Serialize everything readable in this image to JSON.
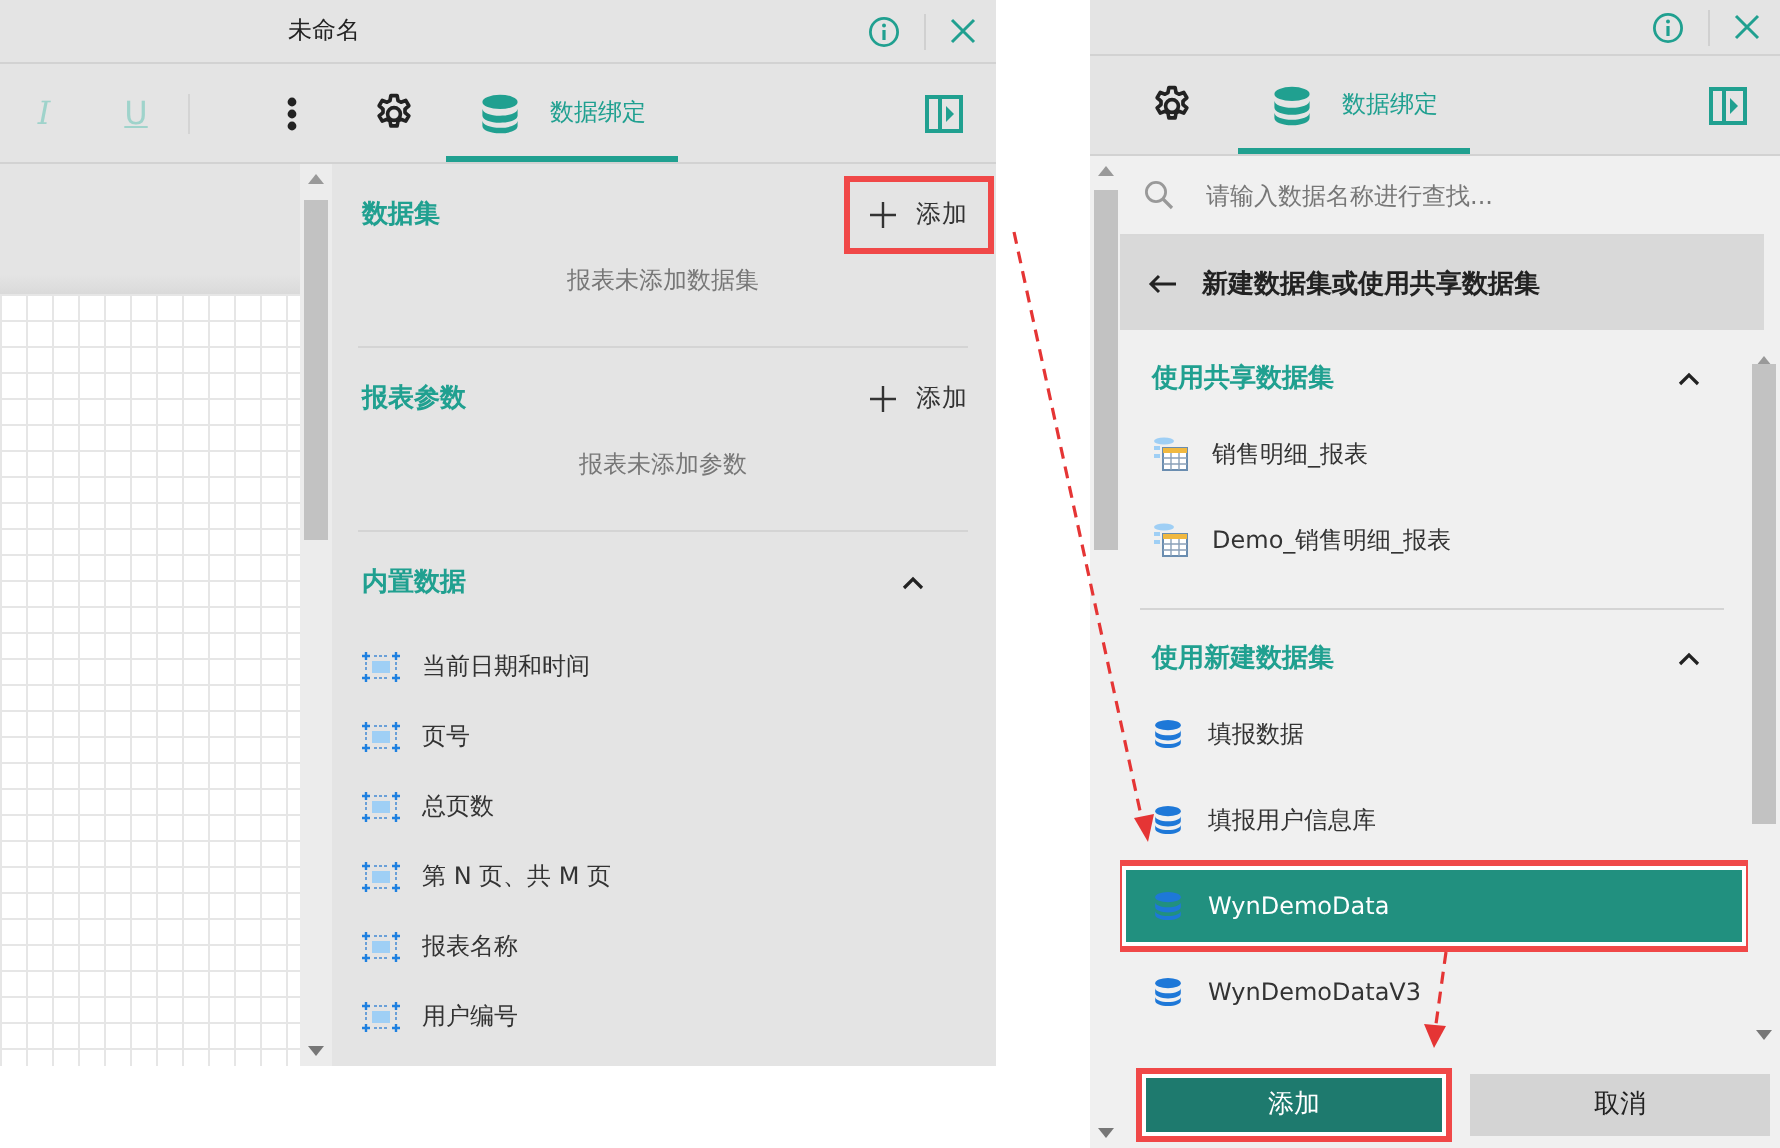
{
  "left_panel": {
    "window": {
      "title": "未命名"
    },
    "format_buttons": [
      {
        "label": "I",
        "disabled": true
      },
      {
        "label": "U",
        "disabled": true
      }
    ],
    "tabs": [
      {
        "kind": "settings",
        "selected": false
      },
      {
        "kind": "data",
        "label": "数据绑定",
        "selected": true
      }
    ],
    "sections": [
      {
        "title": "数据集",
        "action": {
          "label": "添加",
          "highlighted": true
        },
        "empty_text": "报表未添加数据集"
      },
      {
        "title": "报表参数",
        "action": {
          "label": "添加",
          "highlighted": false
        },
        "empty_text": "报表未添加参数"
      }
    ],
    "builtin": {
      "title": "内置数据",
      "expanded": true,
      "items": [
        "当前日期和时间",
        "页号",
        "总页数",
        "第 N 页、共 M 页",
        "报表名称",
        "用户编号"
      ]
    }
  },
  "right_panel": {
    "tabs": [
      {
        "kind": "settings",
        "selected": false
      },
      {
        "kind": "data",
        "label": "数据绑定",
        "selected": true
      }
    ],
    "search": {
      "placeholder": "请输入数据名称进行查找..."
    },
    "back_header": "新建数据集或使用共享数据集",
    "groups": [
      {
        "title": "使用共享数据集",
        "expanded": true,
        "items": [
          {
            "label": "销售明细_报表",
            "kind": "shared",
            "selected": false,
            "highlighted": false
          },
          {
            "label": "Demo_销售明细_报表",
            "kind": "shared",
            "selected": false,
            "highlighted": false
          }
        ]
      },
      {
        "title": "使用新建数据集",
        "expanded": true,
        "items": [
          {
            "label": "填报数据",
            "kind": "database",
            "selected": false,
            "highlighted": false
          },
          {
            "label": "填报用户信息库",
            "kind": "database",
            "selected": false,
            "highlighted": false
          },
          {
            "label": "WynDemoData",
            "kind": "database",
            "selected": true,
            "highlighted": true
          },
          {
            "label": "WynDemoDataV3",
            "kind": "database",
            "selected": false,
            "highlighted": false
          }
        ]
      }
    ],
    "buttons": [
      {
        "label": "添加",
        "kind": "primary",
        "highlighted": true
      },
      {
        "label": "取消",
        "kind": "secondary",
        "highlighted": false
      }
    ]
  }
}
